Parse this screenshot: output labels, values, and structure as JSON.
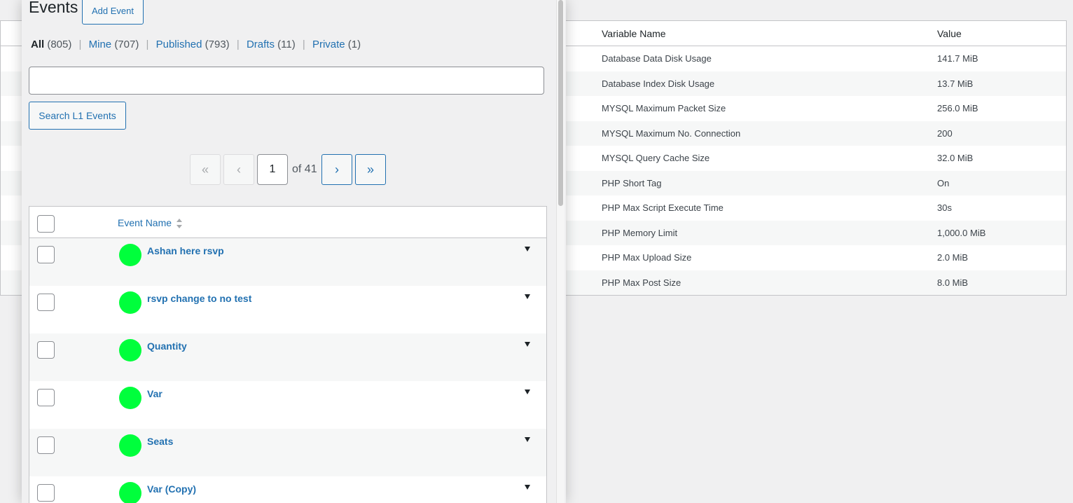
{
  "background_table": {
    "headers": {
      "name": "Variable Name",
      "value": "Value"
    },
    "rows": [
      {
        "name": "Database Data Disk Usage",
        "value": "141.7 MiB"
      },
      {
        "name": "Database Index Disk Usage",
        "value": "13.7 MiB"
      },
      {
        "name": "MYSQL Maximum Packet Size",
        "value": "256.0 MiB"
      },
      {
        "name": "MYSQL Maximum No. Connection",
        "value": "200"
      },
      {
        "name": "MYSQL Query Cache Size",
        "value": "32.0 MiB"
      },
      {
        "name": "PHP Short Tag",
        "value": "On"
      },
      {
        "name": "PHP Max Script Execute Time",
        "value": "30s"
      },
      {
        "name": "PHP Memory Limit",
        "value": "1,000.0 MiB"
      },
      {
        "name": "PHP Max Upload Size",
        "value": "2.0 MiB"
      },
      {
        "name": "PHP Max Post Size",
        "value": "8.0 MiB"
      }
    ]
  },
  "panel": {
    "title": "Events",
    "add_button": "Add Event",
    "filters": {
      "all_label": "All",
      "all_count": "(805)",
      "mine_label": "Mine",
      "mine_count": "(707)",
      "published_label": "Published",
      "published_count": "(793)",
      "drafts_label": "Drafts",
      "drafts_count": "(11)",
      "private_label": "Private",
      "private_count": "(1)",
      "separator": "|"
    },
    "search": {
      "value": "",
      "button": "Search L1 Events"
    },
    "pagination": {
      "first": "«",
      "prev": "‹",
      "current_page": "1",
      "of_label": "of 41",
      "next": "›",
      "last": "»"
    },
    "table": {
      "column_header": "Event Name",
      "events": [
        {
          "name": "Ashan here rsvp"
        },
        {
          "name": "rsvp change to no test"
        },
        {
          "name": "Quantity"
        },
        {
          "name": "Var"
        },
        {
          "name": "Seats"
        },
        {
          "name": "Var (Copy)"
        }
      ]
    },
    "colors": {
      "link": "#2271b1",
      "status_dot": "#00ff3c"
    }
  }
}
